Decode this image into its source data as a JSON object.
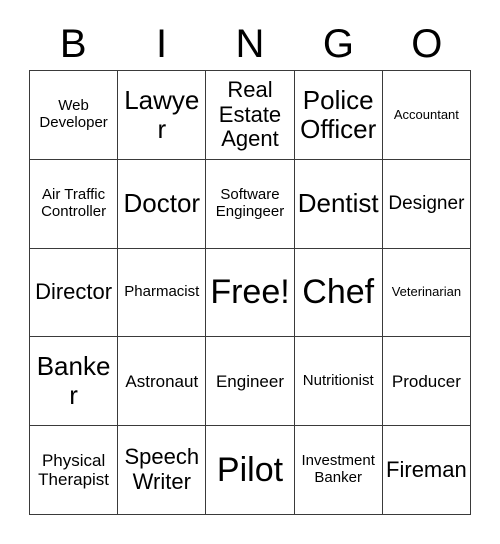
{
  "card": {
    "title": "BINGO",
    "header_letters": [
      "B",
      "I",
      "N",
      "G",
      "O"
    ],
    "free_space_label": "Free!",
    "colors": {
      "background": "#ffffff",
      "border": "#3a3a3a",
      "text": "#000000"
    },
    "grid": {
      "rows": 5,
      "columns": 5
    },
    "cells": [
      [
        {
          "text": "Web Developer",
          "size": "fs-sm"
        },
        {
          "text": "Lawyer",
          "size": "fs-xxl"
        },
        {
          "text": "Real Estate Agent",
          "size": "fs-xl"
        },
        {
          "text": "Police Officer",
          "size": "fs-xxl"
        },
        {
          "text": "Accountant",
          "size": "fs-xs"
        }
      ],
      [
        {
          "text": "Air Traffic Controller",
          "size": "fs-sm"
        },
        {
          "text": "Doctor",
          "size": "fs-xxl"
        },
        {
          "text": "Software Engingeer",
          "size": "fs-sm"
        },
        {
          "text": "Dentist",
          "size": "fs-xxl"
        },
        {
          "text": "Designer",
          "size": "fs-lg"
        }
      ],
      [
        {
          "text": "Director",
          "size": "fs-xl"
        },
        {
          "text": "Pharmacist",
          "size": "fs-sm"
        },
        {
          "text": "Free!",
          "size": "fs-free"
        },
        {
          "text": "Chef",
          "size": "fs-free"
        },
        {
          "text": "Veterinarian",
          "size": "fs-xs"
        }
      ],
      [
        {
          "text": "Banker",
          "size": "fs-xxl"
        },
        {
          "text": "Astronaut",
          "size": "fs-md"
        },
        {
          "text": "Engineer",
          "size": "fs-md"
        },
        {
          "text": "Nutritionist",
          "size": "fs-sm"
        },
        {
          "text": "Producer",
          "size": "fs-md"
        }
      ],
      [
        {
          "text": "Physical Therapist",
          "size": "fs-md"
        },
        {
          "text": "Speech Writer",
          "size": "fs-xl"
        },
        {
          "text": "Pilot",
          "size": "fs-free"
        },
        {
          "text": "Investment Banker",
          "size": "fs-sm"
        },
        {
          "text": "Fireman",
          "size": "fs-xl"
        }
      ]
    ]
  }
}
